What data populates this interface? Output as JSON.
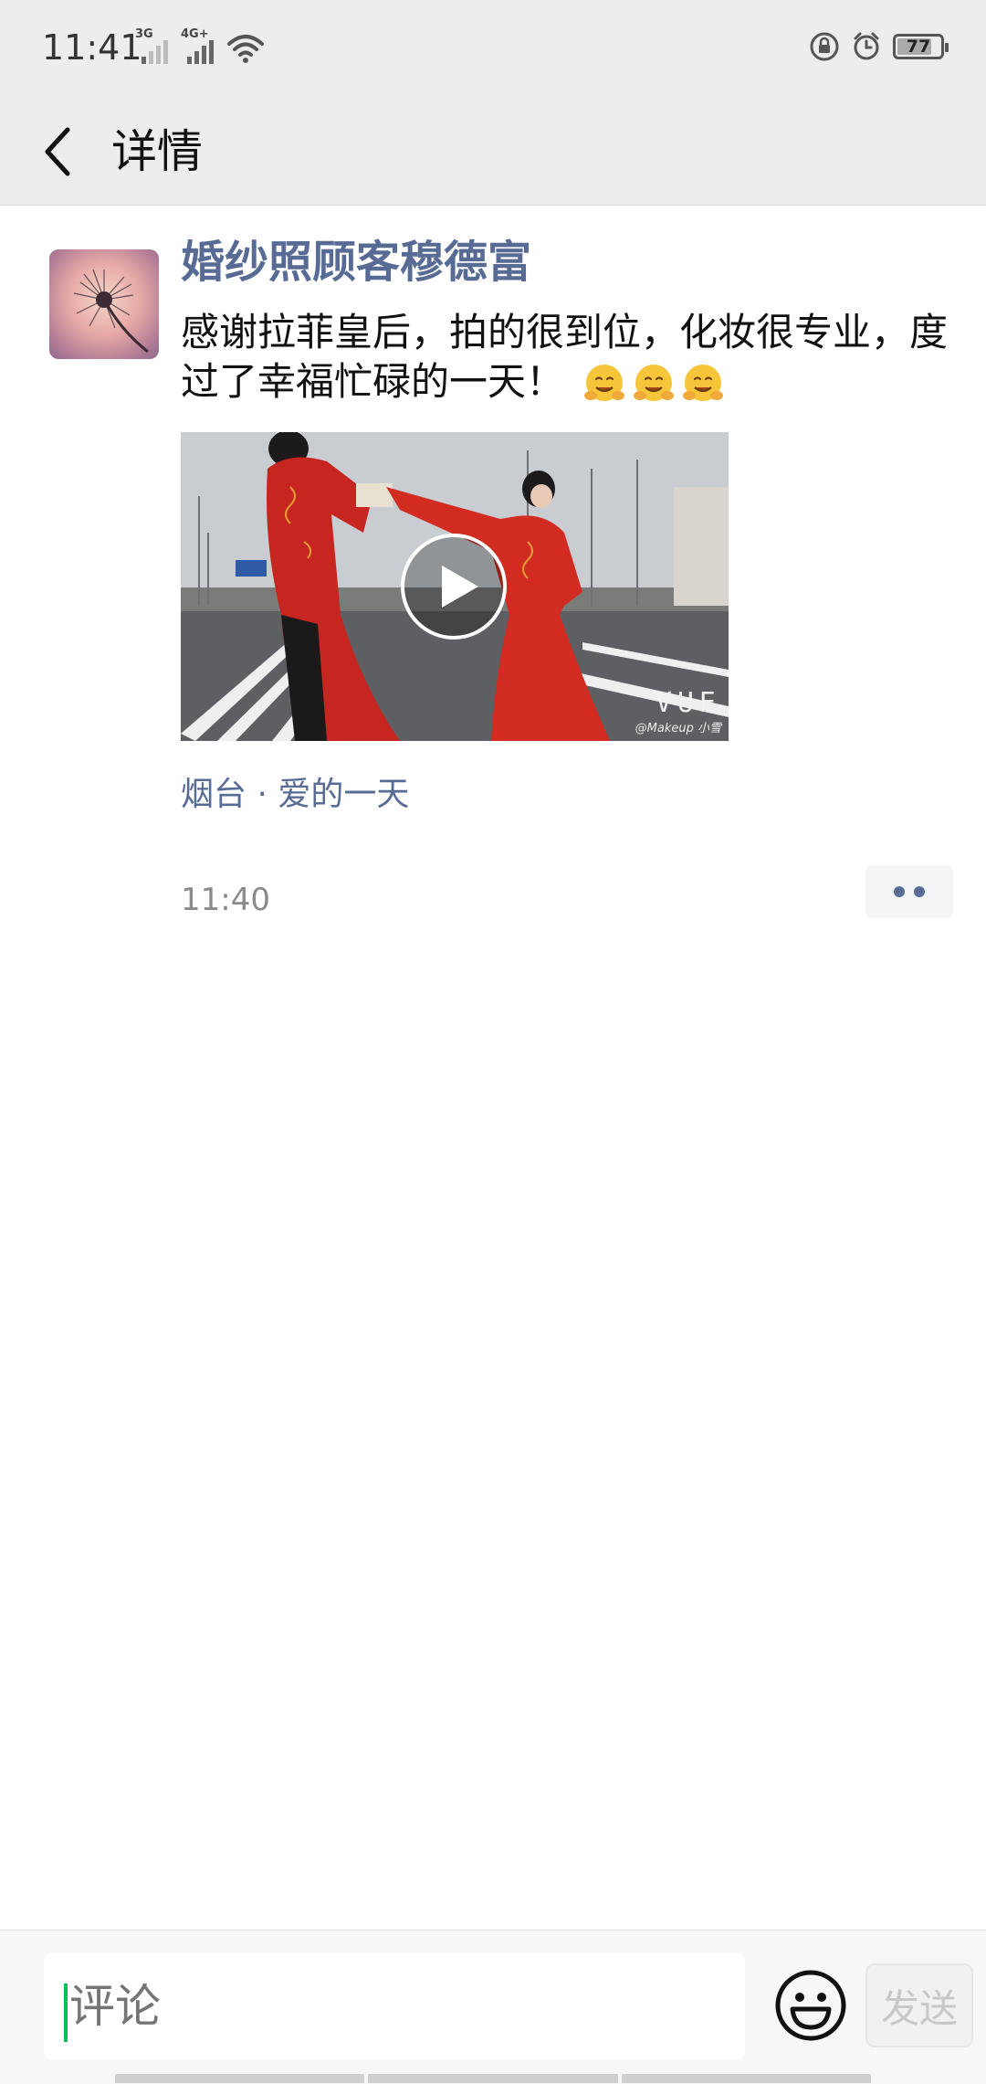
{
  "status_bar": {
    "time": "11:41",
    "network_1": "3G",
    "network_2": "4G+",
    "battery": "77",
    "icons": [
      "signal-3g-icon",
      "signal-4g-icon",
      "wifi-icon",
      "rotation-lock-icon",
      "alarm-icon",
      "battery-icon"
    ]
  },
  "header": {
    "title": "详情",
    "back_icon": "chevron-left-icon"
  },
  "post": {
    "author": "婚纱照顾客穆德富",
    "text": "感谢拉菲皇后，拍的很到位，化妆很专业，度过了幸福忙碌的一天！",
    "emoji": "hugging-face-emoji",
    "emoji_count": 3,
    "video": {
      "watermark": "VUE",
      "watermark_sub": "@Makeup 小雪",
      "play_icon": "play-icon"
    },
    "location": "烟台 · 爱的一天",
    "time": "11:40",
    "more_icon": "more-dots-icon"
  },
  "comment_bar": {
    "placeholder": "评论",
    "emoji_icon": "smiley-icon",
    "send_label": "发送"
  },
  "colors": {
    "link": "#576b95",
    "accent": "#07c160",
    "header_bg": "#ededed"
  }
}
